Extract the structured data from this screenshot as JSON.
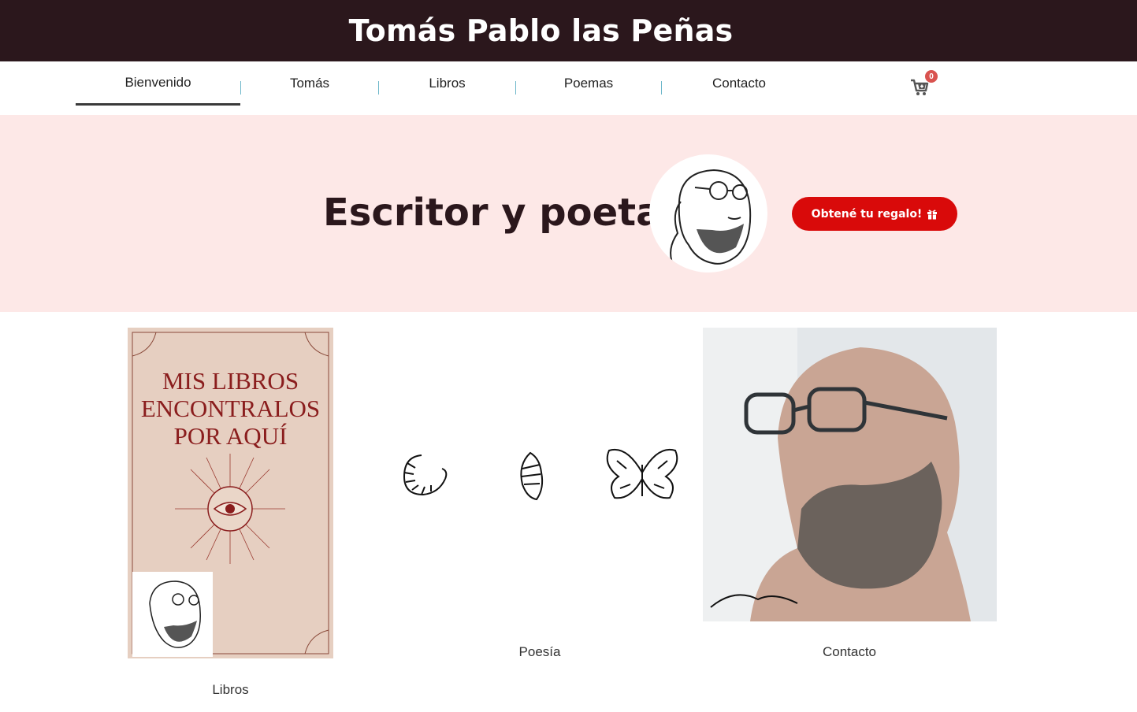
{
  "header": {
    "site_title": "Tomás Pablo las Peñas"
  },
  "nav": {
    "items": [
      {
        "label": "Bienvenido",
        "active": true
      },
      {
        "label": "Tomás"
      },
      {
        "label": "Libros"
      },
      {
        "label": "Poemas"
      },
      {
        "label": "Contacto"
      }
    ],
    "cart_count": "0",
    "cart_icon": "cart-plus-icon"
  },
  "hero": {
    "title": "Escritor y poeta",
    "cta_label": "Obtené tu regalo!",
    "cta_icon": "gift-icon",
    "background_color": "#fde8e7",
    "cta_color": "#d90a0a"
  },
  "cards": {
    "books": {
      "cover_lines": [
        "MIS LIBROS",
        "ENCONTRALOS",
        "POR AQUÍ"
      ],
      "caption": "Libros"
    },
    "poetry": {
      "caption": "Poesía"
    },
    "contact": {
      "caption": "Contacto"
    }
  },
  "colors": {
    "topbar": "#2b171c",
    "accent_red": "#d90a0a"
  }
}
